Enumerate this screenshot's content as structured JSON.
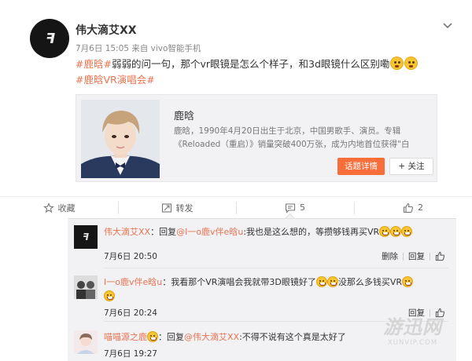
{
  "post": {
    "author": "伟大滴艾XX",
    "timestamp": "7月6日 15:05",
    "source": "来自 vivo智能手机",
    "text_tag1": "#鹿晗#",
    "text_body": "弱弱的问一句，那个vr眼镜是怎么个样子，和3d眼镜什么区别嘞",
    "text_tag2": "#鹿晗VR演唱会#",
    "emoji_names": [
      "thinking-emoji",
      "thinking-emoji"
    ]
  },
  "card": {
    "title": "鹿晗",
    "description": "鹿晗，1990年4月20日出生于北京，中国男歌手、演员。专辑《Reloaded（重启）》销量突破400万张，成为内地首位获得\"白",
    "detail_button": "话题详情",
    "follow_button": "+ 关注"
  },
  "actions": {
    "favorite": "收藏",
    "repost": "转发",
    "comment_count": "5",
    "like_count": "2"
  },
  "comments": [
    {
      "user": "伟大滴艾XX",
      "prefix": "：回复",
      "mention": "@I一o鹿v伴e晗u",
      "text": ":我也是这么想的，等攒够钱再买VR",
      "time": "7月6日 20:50",
      "reply": "回复",
      "like": "赞",
      "delete": "删除"
    },
    {
      "user": "I一o鹿v伴e晗u",
      "text_a": "：我看那个VR演唱会我就带3D眼镜好了",
      "text_b": "没那么多钱买VR",
      "time": "7月6日 20:24",
      "reply": "回复"
    },
    {
      "user": "喵喵源之鹿",
      "prefix": "：回复",
      "mention": "@伟大滴艾XX",
      "text": ":不得不说有这个真是太好了",
      "time": "7月6日 19:27"
    }
  ],
  "watermark": {
    "big": "游迅网",
    "small": "XUNVIP.COM"
  },
  "colors": {
    "accent": "#eb7350",
    "detail_button": "#f76e3b",
    "panel_bg": "#f2f2f5"
  }
}
